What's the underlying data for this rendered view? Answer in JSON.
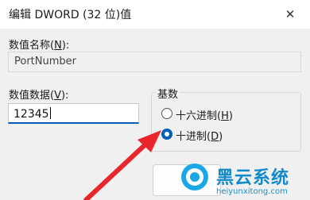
{
  "window": {
    "title": "编辑 DWORD (32 位)值",
    "close_glyph": "✕"
  },
  "value_name": {
    "label_main": "数值名称(",
    "label_key": "N",
    "label_end": "):",
    "value": "PortNumber"
  },
  "value_data": {
    "label_main": "数值数据(",
    "label_key": "V",
    "label_end": "):",
    "value": "12345"
  },
  "base": {
    "title": "基数",
    "options": [
      {
        "label_main": "十六进制(",
        "label_key": "H",
        "label_end": ")",
        "selected": false
      },
      {
        "label_main": "十进制(",
        "label_key": "D",
        "label_end": ")",
        "selected": true
      }
    ]
  },
  "watermark": {
    "brand": "黑云系统",
    "url": "heiyunxitong.com"
  },
  "colors": {
    "accent": "#005fb8",
    "arrow": "#e8262b"
  }
}
